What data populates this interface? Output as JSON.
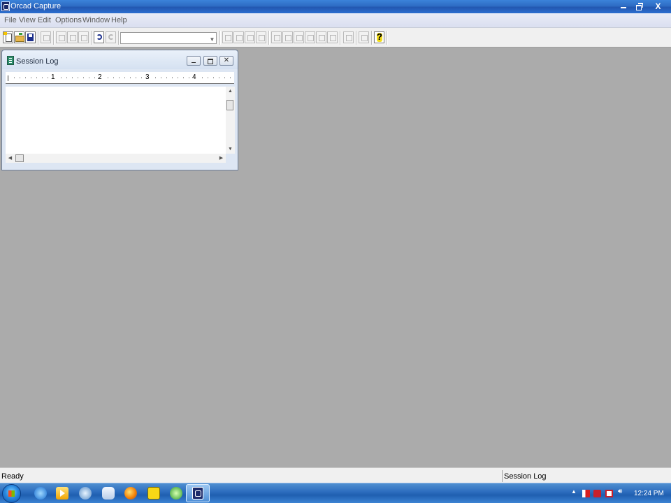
{
  "window": {
    "title": "Orcad Capture",
    "controls": {
      "minimize_icon": "minimize-icon",
      "restore_icon": "restore-icon",
      "close_label": "X"
    }
  },
  "menu": {
    "items": [
      "File",
      "View",
      "Edit",
      "Options",
      "Window",
      "Help"
    ]
  },
  "toolbar": {
    "buttons": [
      {
        "icon": "new-document-icon",
        "enabled": true
      },
      {
        "icon": "open-folder-icon",
        "enabled": true
      },
      {
        "icon": "save-disk-icon",
        "enabled": true
      },
      {
        "icon": "print-icon",
        "enabled": false
      },
      {
        "icon": "cut-icon",
        "enabled": false
      },
      {
        "icon": "copy-icon",
        "enabled": false
      },
      {
        "icon": "paste-icon",
        "enabled": false
      },
      {
        "icon": "undo-icon",
        "enabled": true
      },
      {
        "icon": "redo-icon",
        "enabled": false
      },
      {
        "icon": "zoom-in-icon",
        "enabled": false
      },
      {
        "icon": "zoom-out-icon",
        "enabled": false
      },
      {
        "icon": "zoom-area-icon",
        "enabled": false
      },
      {
        "icon": "zoom-all-icon",
        "enabled": false
      },
      {
        "icon": "annotate-icon",
        "enabled": false
      },
      {
        "icon": "back-annotate-icon",
        "enabled": false
      },
      {
        "icon": "design-rules-check-icon",
        "enabled": false
      },
      {
        "icon": "create-netlist-icon",
        "enabled": false
      },
      {
        "icon": "cross-reference-icon",
        "enabled": false
      },
      {
        "icon": "bill-of-materials-icon",
        "enabled": false
      },
      {
        "icon": "snap-to-grid-icon",
        "enabled": false
      },
      {
        "icon": "project-manager-icon",
        "enabled": false
      },
      {
        "icon": "help-icon",
        "enabled": true
      }
    ],
    "part_combo_value": ""
  },
  "session_log": {
    "title": "Session Log",
    "ruler_numbers": [
      "1",
      "2",
      "3",
      "4"
    ],
    "content": ""
  },
  "status": {
    "left_text": "Ready",
    "right_text": "Session Log"
  },
  "taskbar": {
    "start_icon": "windows-start-orb-icon",
    "pinned": [
      "internet-explorer-icon",
      "media-player-icon",
      "network-icon",
      "device-icon",
      "firefox-icon",
      "sticky-notes-icon",
      "green-app-icon",
      "orcad-capture-icon"
    ],
    "active_app": "orcad-capture-icon",
    "tray": {
      "icons": [
        "show-hidden-icons-icon",
        "action-center-flag-icon",
        "power-icon",
        "network-status-icon",
        "volume-icon"
      ],
      "clock": "12:24 PM"
    }
  },
  "colors": {
    "workspace": "#ababab",
    "title_bar": "#2e6cc4",
    "taskbar": "#2f6fc0",
    "help_icon": "#f2dc1a"
  }
}
